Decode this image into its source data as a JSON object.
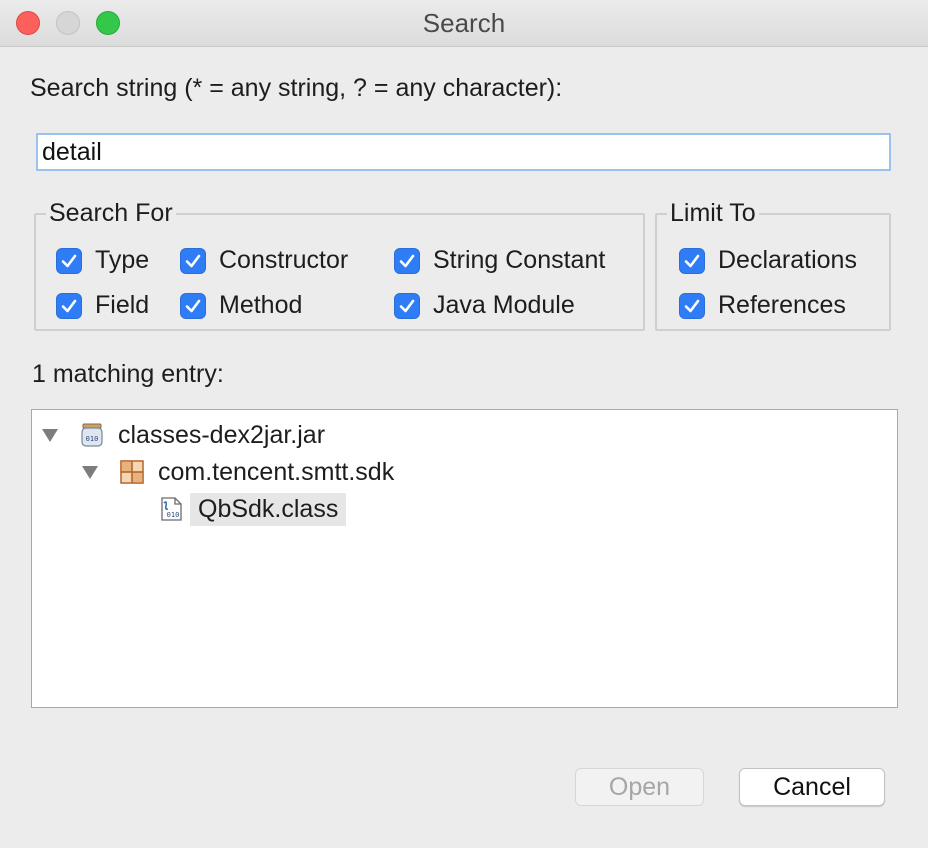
{
  "window": {
    "title": "Search"
  },
  "search": {
    "label": "Search string (* = any string, ? = any character):",
    "value": "detail"
  },
  "search_for": {
    "legend": "Search For",
    "options": [
      {
        "label": "Type",
        "checked": true
      },
      {
        "label": "Constructor",
        "checked": true
      },
      {
        "label": "String Constant",
        "checked": true
      },
      {
        "label": "Field",
        "checked": true
      },
      {
        "label": "Method",
        "checked": true
      },
      {
        "label": "Java Module",
        "checked": true
      }
    ]
  },
  "limit_to": {
    "legend": "Limit To",
    "options": [
      {
        "label": "Declarations",
        "checked": true
      },
      {
        "label": "References",
        "checked": true
      }
    ]
  },
  "results": {
    "label": "1 matching entry:",
    "tree": [
      {
        "label": "classes-dex2jar.jar",
        "icon": "jar-icon",
        "expanded": true
      },
      {
        "label": "com.tencent.smtt.sdk",
        "icon": "package-icon",
        "expanded": true
      },
      {
        "label": "QbSdk.class",
        "icon": "class-file-icon",
        "selected": true
      }
    ]
  },
  "buttons": {
    "open": "Open",
    "cancel": "Cancel"
  },
  "colors": {
    "checkbox": "#2f7df6",
    "close": "#fc605c",
    "maximize": "#34c84a",
    "focus_border": "#9cc3ef"
  }
}
